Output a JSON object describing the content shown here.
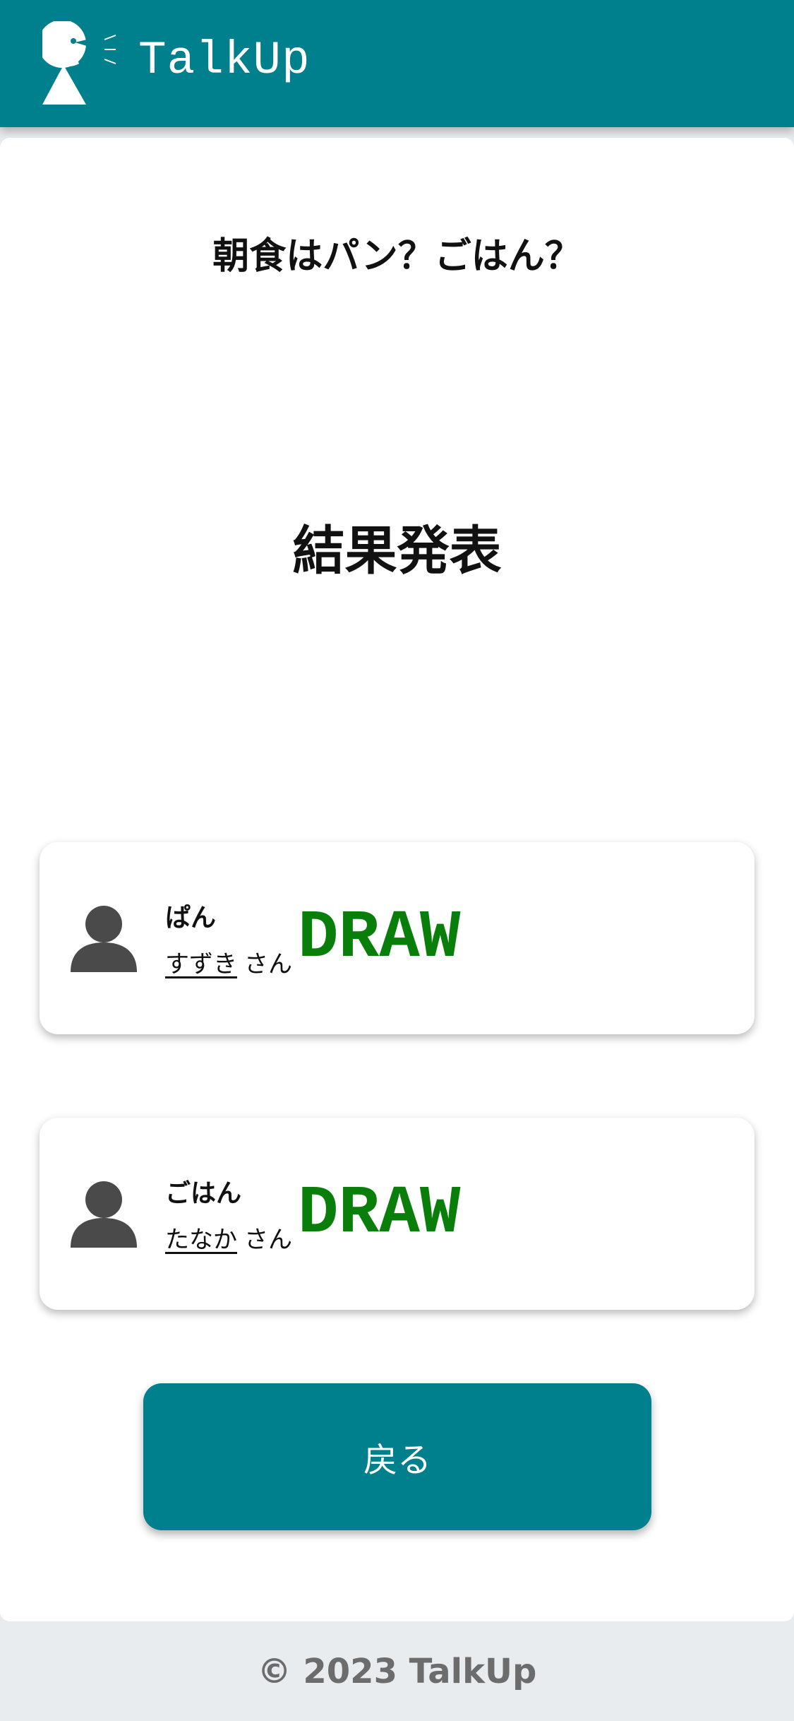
{
  "header": {
    "app_name": "TalkUp",
    "logo_icon": "speaking-person-icon",
    "color": "#00808c"
  },
  "main": {
    "question": "朝食はパン？ごはん？",
    "result_title": "結果発表",
    "players": [
      {
        "choice": "ぱん",
        "name": "すずき",
        "suffix": "さん",
        "result": "DRAW",
        "avatar_icon": "user-icon"
      },
      {
        "choice": "ごはん",
        "name": "たなか",
        "suffix": "さん",
        "result": "DRAW",
        "avatar_icon": "user-icon"
      }
    ],
    "result_color": "#0a7e0a",
    "back_label": "戻る"
  },
  "footer": {
    "text": "© 2023 TalkUp"
  }
}
